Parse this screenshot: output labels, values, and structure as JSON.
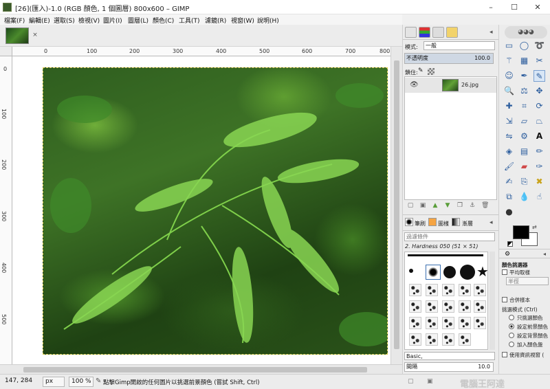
{
  "window": {
    "title": "[26](匯入)-1.0 (RGB 顏色, 1 個圖層) 800x600 – GIMP",
    "minimize": "–",
    "maximize": "☐",
    "close": "✕"
  },
  "menu": [
    "檔案(F)",
    "編輯(E)",
    "選取(S)",
    "檢視(V)",
    "圖片(I)",
    "圖層(L)",
    "顏色(C)",
    "工具(T)",
    "濾鏡(R)",
    "視窗(W)",
    "說明(H)"
  ],
  "image_tab": {
    "close_glyph": "×"
  },
  "ruler": {
    "h_labels": [
      "0",
      "100",
      "200",
      "300",
      "400",
      "500",
      "600",
      "700",
      "800"
    ],
    "v_labels": [
      "0",
      "100",
      "200",
      "300",
      "400",
      "500"
    ]
  },
  "status": {
    "coords": "147, 284",
    "unit": "px",
    "zoom": "100 %",
    "message": "點擊Gimp開啟的任何圖片以挑選前景顏色 (嘗試 Shift, Ctrl)"
  },
  "layers": {
    "mode_label": "模式:",
    "mode_value": "一般",
    "opacity_label": "不透明度",
    "opacity_value": "100.0",
    "lock_label": "鎖住:",
    "layer_name": "26.jpg"
  },
  "brushes": {
    "tabs": [
      "筆刷",
      "圖樣",
      "漸層"
    ],
    "filter_placeholder": "過濾條件",
    "current": "2. Hardness 050 (51 × 51)",
    "preset": "Basic,",
    "spacing_label": "間隔",
    "spacing_value": "10.0"
  },
  "toolbox": {
    "tool_options_title": "顏色挑選器",
    "sample_average": "平均取樣",
    "radius_label": "半徑",
    "merged": "合併樣本",
    "pick_mode": "挑選模式 (Ctrl)",
    "pick_only": "只挑選顏色",
    "pick_fg": "設定前景顏色",
    "pick_bg": "設定背景顏色",
    "pick_palette": "加入顏色盤",
    "use_info": "使用資訊視窗 (",
    "watermark": "電腦王阿達"
  },
  "colors": {
    "foreground": "#000000",
    "background": "#ffffff",
    "title_bar": "#ffffff",
    "panel": "#ececec"
  }
}
